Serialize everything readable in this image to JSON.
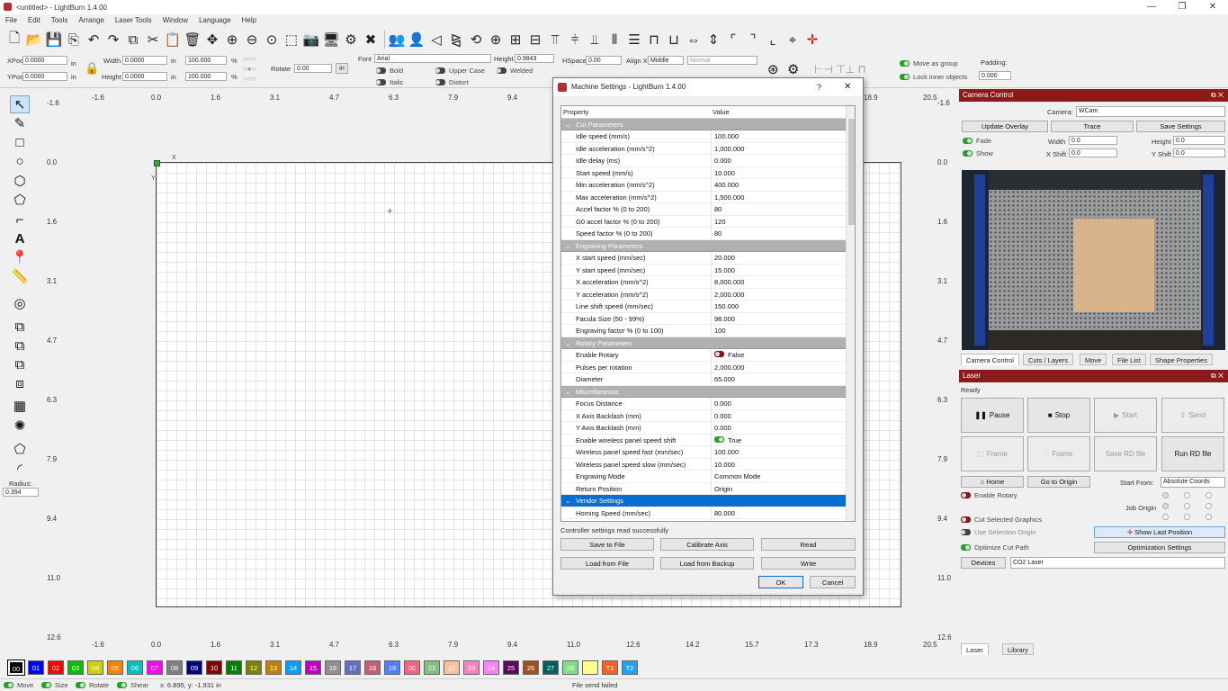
{
  "window": {
    "title": "<untitled> - LightBurn 1.4.00",
    "minimize": "—",
    "maximize": "❐",
    "close": "✕"
  },
  "menu": [
    "File",
    "Edit",
    "Tools",
    "Arrange",
    "Laser Tools",
    "Window",
    "Language",
    "Help"
  ],
  "toolbar2": {
    "xpos_label": "XPos",
    "xpos": "0.0000",
    "ypos_label": "YPos",
    "ypos": "0.0000",
    "in1": "in",
    "in2": "in",
    "width_label": "Width",
    "width": "0.0000",
    "height_label": "Height",
    "height": "0.0000",
    "in3": "in",
    "in4": "in",
    "scale_w": "100.000",
    "scale_h": "100.000",
    "pct1": "%",
    "pct2": "%",
    "rotate_label": "Rotate",
    "rotate": "0.00",
    "units_btn": "in",
    "font_label": "Font",
    "font": "Arial",
    "height2_label": "Height",
    "height2": "0.9843",
    "hspace_label": "HSpace",
    "hspace": "0.00",
    "alignx_label": "Align X",
    "alignx": "Middle",
    "normal": "Normal",
    "bold": "Bold",
    "upper": "Upper Case",
    "welded": "Welded",
    "italic": "Italic",
    "distort": "Distort",
    "move_group": "Move as group",
    "lock_inner": "Lock inner objects",
    "padding_label": "Padding:",
    "padding": "0.000"
  },
  "canvas": {
    "top_ruler": [
      "-1.6",
      "0.0",
      "1.6",
      "3.1",
      "4.7",
      "6.3",
      "7.9",
      "9.4",
      "18.9",
      "20.5"
    ],
    "bottom_ruler": [
      "-1.6",
      "0.0",
      "1.6",
      "3.1",
      "4.7",
      "6.3",
      "7.9",
      "9.4",
      "11.0",
      "12.6",
      "14.2",
      "15.7",
      "17.3",
      "18.9",
      "20.5"
    ],
    "left_ruler": [
      "-1.6",
      "0.0",
      "1.6",
      "3.1",
      "4.7",
      "6.3",
      "7.9",
      "9.4",
      "11.0",
      "12.6"
    ],
    "right_ruler": [
      "-1.6",
      "0.0",
      "1.6",
      "3.1",
      "4.7",
      "6.3",
      "7.9",
      "9.4",
      "11.0",
      "12.6"
    ],
    "x_axis": "X",
    "y_axis": "Y"
  },
  "left_tools": {
    "radius_label": "Radius:",
    "radius": "0.394"
  },
  "dialog": {
    "title": "Machine Settings - LightBurn 1.4.00",
    "help": "?",
    "close": "✕",
    "col_property": "Property",
    "col_value": "Value",
    "rows": [
      {
        "t": "sec",
        "k": "Cut Parameters",
        "v": ""
      },
      {
        "t": "row",
        "k": "Idle speed (mm/s)",
        "v": "100.000"
      },
      {
        "t": "row",
        "k": "Idle acceleration (mm/s^2)",
        "v": "1,000.000"
      },
      {
        "t": "row",
        "k": "Idle delay (ms)",
        "v": "0.000"
      },
      {
        "t": "row",
        "k": "Start speed (mm/s)",
        "v": "10.000"
      },
      {
        "t": "row",
        "k": "Min acceleration (mm/s^2)",
        "v": "400.000"
      },
      {
        "t": "row",
        "k": "Max acceleration (mm/s^2)",
        "v": "1,500.000"
      },
      {
        "t": "row",
        "k": "Accel factor % (0 to 200)",
        "v": "80"
      },
      {
        "t": "row",
        "k": "G0 accel factor % (0 to 200)",
        "v": "120"
      },
      {
        "t": "row",
        "k": "Speed factor % (0 to 200)",
        "v": "80"
      },
      {
        "t": "sec",
        "k": "Engraving Parameters",
        "v": ""
      },
      {
        "t": "row",
        "k": "X start speed (mm/sec)",
        "v": "20.000"
      },
      {
        "t": "row",
        "k": "Y start speed (mm/sec)",
        "v": "15.000"
      },
      {
        "t": "row",
        "k": "X acceleration (mm/s^2)",
        "v": "8,000.000"
      },
      {
        "t": "row",
        "k": "Y acceleration (mm/s^2)",
        "v": "2,000.000"
      },
      {
        "t": "row",
        "k": "Line shift speed (mm/sec)",
        "v": "150.000"
      },
      {
        "t": "row",
        "k": "Facula Size (50 - 99%)",
        "v": "98.000"
      },
      {
        "t": "row",
        "k": "Engraving factor % (0 to 100)",
        "v": "100"
      },
      {
        "t": "sec",
        "k": "Rotary Parameters",
        "v": ""
      },
      {
        "t": "toggle-off",
        "k": "Enable Rotary",
        "v": "False"
      },
      {
        "t": "row",
        "k": "Pulses per rotation",
        "v": "2,000.000"
      },
      {
        "t": "row",
        "k": "Diameter",
        "v": "65.000"
      },
      {
        "t": "sec",
        "k": "Miscellaneous",
        "v": ""
      },
      {
        "t": "row",
        "k": "Focus Distance",
        "v": "0.000"
      },
      {
        "t": "row",
        "k": "X Axis Backlash (mm)",
        "v": "0.000"
      },
      {
        "t": "row",
        "k": "Y Axis Backlash (mm)",
        "v": "0.000"
      },
      {
        "t": "toggle-on",
        "k": "Enable wireless panel speed shift",
        "v": "True"
      },
      {
        "t": "row",
        "k": "Wireless panel speed fast (mm/sec)",
        "v": "100.000"
      },
      {
        "t": "row",
        "k": "Wireless panel speed slow (mm/sec)",
        "v": "10.000"
      },
      {
        "t": "row",
        "k": "Engraving Mode",
        "v": "Common Mode"
      },
      {
        "t": "row",
        "k": "Return Position",
        "v": "Origin"
      },
      {
        "t": "sel",
        "k": "Vendor Settings",
        "v": ""
      },
      {
        "t": "row",
        "k": "Homing Speed (mm/sec)",
        "v": "80.000"
      }
    ],
    "status": "Controller settings read successfully",
    "btn_save": "Save to File",
    "btn_calibrate": "Calibrate Axis",
    "btn_read": "Read",
    "btn_load": "Load from File",
    "btn_backup": "Load from Backup",
    "btn_write": "Write",
    "btn_ok": "OK",
    "btn_cancel": "Cancel"
  },
  "camera": {
    "header": "Camera Control",
    "camera_label": "Camera:",
    "camera": "WCam",
    "update_overlay": "Update Overlay",
    "trace": "Trace",
    "save_settings": "Save Settings",
    "fade": "Fade",
    "show": "Show",
    "width_label": "Width",
    "width": "0.0",
    "height_label": "Height",
    "height": "0.0",
    "xshift_label": "X Shift",
    "xshift": "0.0",
    "yshift_label": "Y Shift",
    "yshift": "0.0",
    "tabs": [
      "Camera Control",
      "Cuts / Layers",
      "Move",
      "File List",
      "Shape Properties"
    ]
  },
  "laser": {
    "header": "Laser",
    "status": "Ready",
    "pause": "Pause",
    "stop": "Stop",
    "start": "Start",
    "send": "Send",
    "frame1": "Frame",
    "frame2": "Frame",
    "save_rd": "Save RD file",
    "run_rd": "Run RD file",
    "home": "Home",
    "go_origin": "Go to Origin",
    "start_from_label": "Start From:",
    "start_from": "Absolute Coords",
    "enable_rotary": "Enable Rotary",
    "job_origin": "Job Origin",
    "cut_selected": "Cut Selected Graphics",
    "use_selection": "Use Selection Origin",
    "show_last": "Show Last Position",
    "optimize_cut": "Optimize Cut Path",
    "optimization": "Optimization Settings",
    "devices": "Devices",
    "device": "CO2 Laser",
    "tabs": [
      "Laser",
      "Library"
    ]
  },
  "palette": [
    {
      "l": "00",
      "c": "#000000"
    },
    {
      "l": "01",
      "c": "#0000ff"
    },
    {
      "l": "02",
      "c": "#ff0000"
    },
    {
      "l": "03",
      "c": "#00c000"
    },
    {
      "l": "04",
      "c": "#d0d000"
    },
    {
      "l": "05",
      "c": "#ff8000"
    },
    {
      "l": "06",
      "c": "#00c0c0"
    },
    {
      "l": "07",
      "c": "#ff00ff"
    },
    {
      "l": "08",
      "c": "#808080"
    },
    {
      "l": "09",
      "c": "#000080"
    },
    {
      "l": "10",
      "c": "#800000"
    },
    {
      "l": "11",
      "c": "#008000"
    },
    {
      "l": "12",
      "c": "#808000"
    },
    {
      "l": "13",
      "c": "#c08000"
    },
    {
      "l": "14",
      "c": "#00a0ff"
    },
    {
      "l": "15",
      "c": "#c000c0"
    },
    {
      "l": "16",
      "c": "#909090"
    },
    {
      "l": "17",
      "c": "#6070c0"
    },
    {
      "l": "18",
      "c": "#c06070"
    },
    {
      "l": "19",
      "c": "#5080ff"
    },
    {
      "l": "20",
      "c": "#ff6080"
    },
    {
      "l": "21",
      "c": "#80c080"
    },
    {
      "l": "22",
      "c": "#ffc0a0"
    },
    {
      "l": "23",
      "c": "#ff80c0"
    },
    {
      "l": "24",
      "c": "#ff80ff"
    },
    {
      "l": "25",
      "c": "#600060"
    },
    {
      "l": "26",
      "c": "#a05020"
    },
    {
      "l": "27",
      "c": "#006060"
    },
    {
      "l": "28",
      "c": "#80e080"
    },
    {
      "l": "29",
      "c": "#ffff80"
    },
    {
      "l": "T1",
      "c": "#ff6020"
    },
    {
      "l": "T2",
      "c": "#20a0ff"
    }
  ],
  "statusbar": {
    "move": "Move",
    "size": "Size",
    "rotate": "Rotate",
    "shear": "Shear",
    "coords": "x: 6.895, y: -1.931 in",
    "message": "File send failed"
  }
}
